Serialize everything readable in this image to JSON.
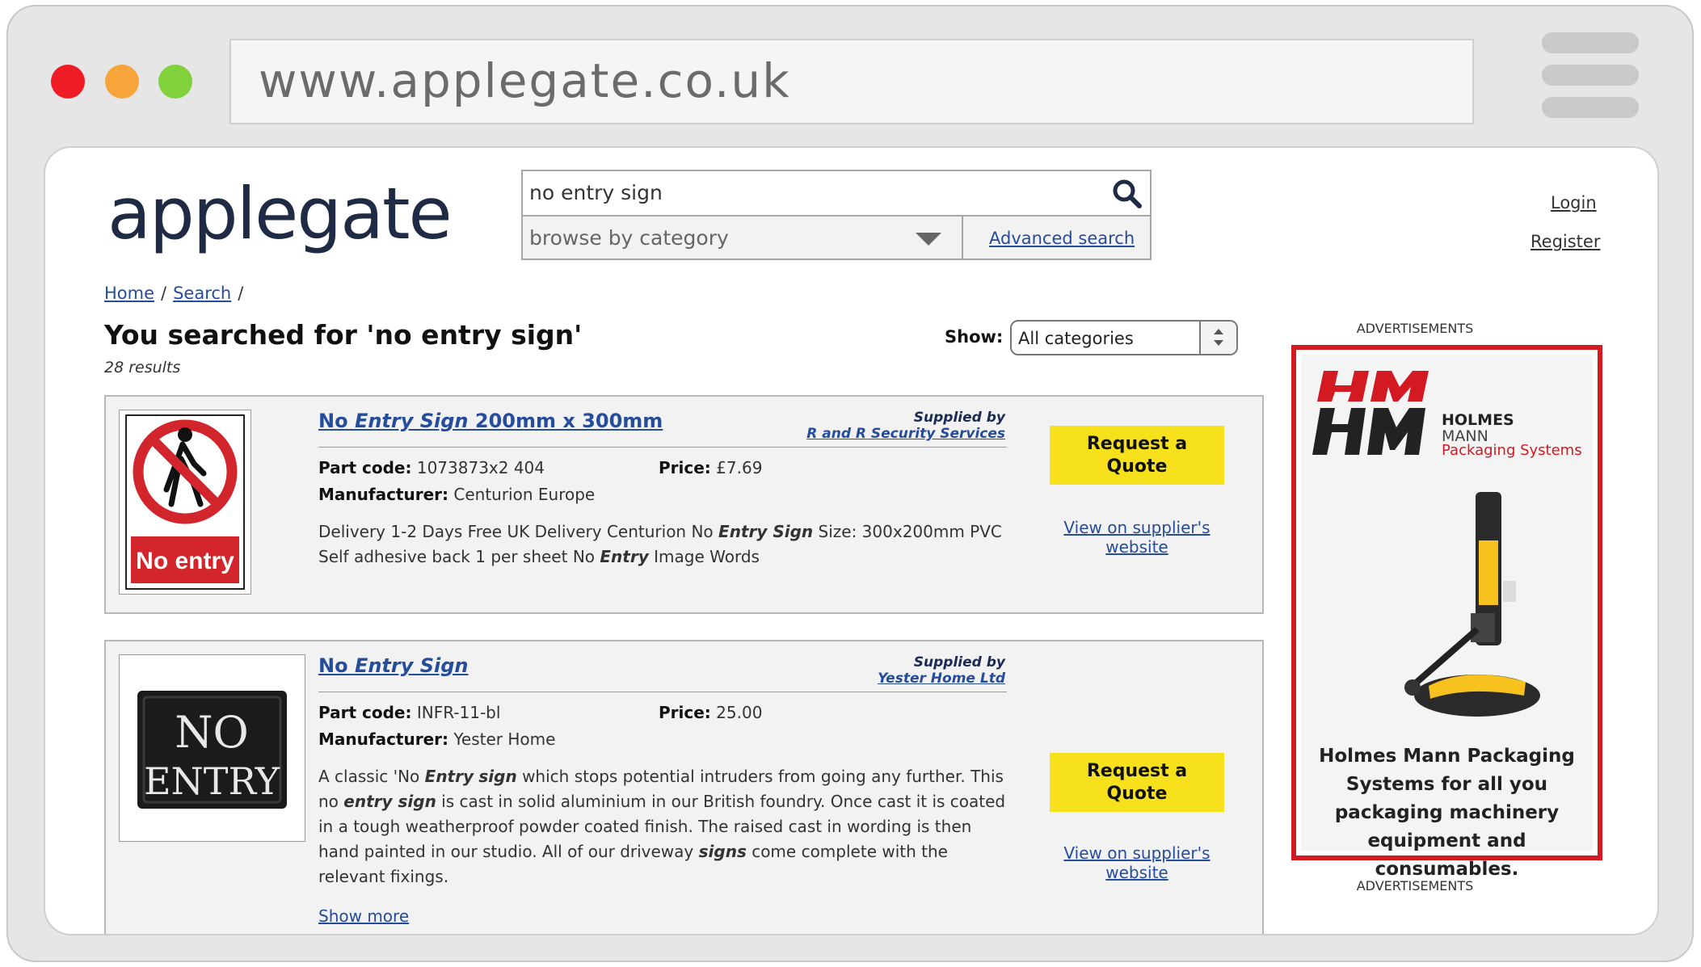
{
  "browser": {
    "url": "www.applegate.co.uk"
  },
  "header": {
    "logo": "applegate",
    "search_value": "no entry sign",
    "browse_label": "browse by category",
    "advanced_search": "Advanced search",
    "login": "Login",
    "register": "Register"
  },
  "breadcrumb": {
    "home": "Home",
    "search": "Search",
    "sep": "/"
  },
  "page": {
    "heading": "You searched for 'no entry sign'",
    "results_count": "28 results",
    "show_label": "Show:",
    "show_value": "All categories"
  },
  "results": [
    {
      "title_a": "No ",
      "title_b": "Entry Sign",
      "title_c": " 200mm x 300mm",
      "supplied_by_label": "Supplied by",
      "supplier": "R and R Security Services",
      "part_code_label": "Part code:",
      "part_code": "1073873x2 404",
      "price_label": "Price:",
      "price": "£7.69",
      "manufacturer_label": "Manufacturer:",
      "manufacturer": "Centurion Europe",
      "description_1": "Delivery 1-2 Days Free UK Delivery Centurion No ",
      "description_2": "Entry Sign",
      "description_3": " Size: 300x200mm PVC Self adhesive back 1 per sheet No ",
      "description_4": "Entry",
      "description_5": " Image Words",
      "image_caption": "No entry",
      "quote_button": "Request a Quote",
      "view_link": "View on supplier's website"
    },
    {
      "title_a": "No ",
      "title_b": "Entry Sign",
      "supplied_by_label": "Supplied by",
      "supplier": "Yester Home Ltd",
      "part_code_label": "Part code:",
      "part_code": "INFR-11-bl",
      "price_label": "Price:",
      "price": "25.00",
      "manufacturer_label": "Manufacturer:",
      "manufacturer": "Yester Home",
      "description_1": "A classic 'No ",
      "description_2": "Entry",
      "description_3": " ",
      "description_4": "sign",
      "description_5": " which stops potential intruders from going any further. This no ",
      "description_6": "entry sign",
      "description_7": " is cast in solid aluminium in our British foundry. Once cast it is coated in a tough weatherproof powder coated finish. The raised cast in wording is then hand painted in our studio. All of our driveway ",
      "description_8": "signs",
      "description_9": " come complete with the relevant fixings.",
      "image_line1": "NO",
      "image_line2": "ENTRY",
      "show_more": "Show more",
      "quote_button": "Request a Quote",
      "view_link": "View on supplier's website"
    }
  ],
  "ad": {
    "label_top": "ADVERTISEMENTS",
    "label_bottom": "ADVERTISEMENTS",
    "brand_line1": "HOLMES",
    "brand_line2": "MANN",
    "brand_line3": "Packaging Systems",
    "text": "Holmes Mann Packaging Systems for all you packaging machinery equipment and consumables."
  },
  "colors": {
    "accent_link": "#264c9c",
    "button": "#f7e11d",
    "ad_border": "#d31921"
  }
}
